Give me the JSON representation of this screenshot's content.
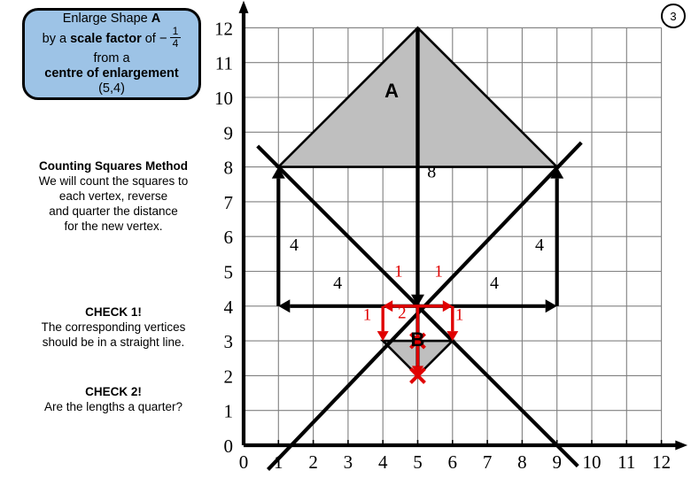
{
  "page": {
    "number": "3"
  },
  "instruction": {
    "line1_prefix": "Enlarge Shape ",
    "line1_shape": "A",
    "line2_prefix": "by a ",
    "line2_bold": "scale factor",
    "line2_suffix": " of",
    "fraction_sign": "−",
    "fraction_numerator": "1",
    "fraction_denominator": "4",
    "line3": "from a",
    "line4": "centre of enlargement",
    "line5": "(5,4)"
  },
  "method": {
    "heading": "Counting Squares Method",
    "lines": [
      "We will count the squares to",
      "each vertex, reverse",
      "and quarter the distance",
      "for the new vertex."
    ]
  },
  "check1": {
    "heading": "CHECK 1!",
    "lines": [
      "The corresponding vertices",
      "should be in a straight line."
    ]
  },
  "check2": {
    "heading": "CHECK 2!",
    "lines": [
      "Are the lengths a quarter?"
    ]
  },
  "colors": {
    "instruction_box_fill": "#9DC3E6",
    "shape_fill": "#BFBFBF",
    "annotation_red": "#E00000",
    "grid": "#808080",
    "axis": "#000000"
  },
  "chart_data": {
    "type": "scatter",
    "title": "",
    "xlabel": "",
    "ylabel": "",
    "xlim": [
      0,
      12
    ],
    "ylim": [
      0,
      12
    ],
    "grid": true,
    "x_ticks": [
      "0",
      "1",
      "2",
      "3",
      "4",
      "5",
      "6",
      "7",
      "8",
      "9",
      "10",
      "11",
      "12"
    ],
    "y_ticks": [
      "0",
      "1",
      "2",
      "3",
      "4",
      "5",
      "6",
      "7",
      "8",
      "9",
      "10",
      "11",
      "12"
    ],
    "shapes": [
      {
        "name": "A",
        "label": "A",
        "label_pos": [
          4.25,
          10.0
        ],
        "fill": "#BFBFBF",
        "vertices": [
          [
            1,
            8
          ],
          [
            5,
            12
          ],
          [
            9,
            8
          ]
        ]
      },
      {
        "name": "B",
        "label": "B",
        "label_pos": [
          5.0,
          2.85
        ],
        "fill": "#BFBFBF",
        "vertices": [
          [
            4,
            3
          ],
          [
            5,
            2
          ],
          [
            6,
            3
          ]
        ]
      }
    ],
    "centre_of_enlargement": [
      5,
      4
    ],
    "ray_lines": [
      {
        "from": [
          0.4,
          8.6
        ],
        "to": [
          9.6,
          -0.6
        ],
        "color": "#000000"
      },
      {
        "from": [
          0.7,
          -0.7
        ],
        "to": [
          9.7,
          8.7
        ],
        "color": "#000000"
      },
      {
        "from": [
          5,
          12
        ],
        "to": [
          5,
          2
        ],
        "color": "#000000"
      }
    ],
    "black_measure_arrows": [
      {
        "from": [
          1,
          4
        ],
        "to": [
          1,
          8
        ],
        "label": "4",
        "label_pos": [
          1.45,
          5.6
        ]
      },
      {
        "from": [
          5,
          4
        ],
        "to": [
          1,
          4
        ],
        "label": "4",
        "label_pos": [
          2.7,
          4.5
        ]
      },
      {
        "from": [
          5,
          12
        ],
        "to": [
          5,
          4
        ],
        "label": "8",
        "label_pos": [
          5.4,
          7.7
        ]
      },
      {
        "from": [
          9,
          4
        ],
        "to": [
          9,
          8
        ],
        "label": "4",
        "label_pos": [
          8.5,
          5.6
        ]
      },
      {
        "from": [
          5,
          4
        ],
        "to": [
          9,
          4
        ],
        "label": "4",
        "label_pos": [
          7.2,
          4.5
        ]
      }
    ],
    "red_measure_arrows": [
      {
        "from": [
          5,
          4
        ],
        "to": [
          4,
          4
        ],
        "label": "1",
        "label_pos": [
          4.45,
          4.85
        ]
      },
      {
        "from": [
          4,
          4
        ],
        "to": [
          4,
          3
        ],
        "label": "1",
        "label_pos": [
          3.55,
          3.6
        ]
      },
      {
        "from": [
          5,
          4
        ],
        "to": [
          6,
          4
        ],
        "label": "1",
        "label_pos": [
          5.6,
          4.85
        ]
      },
      {
        "from": [
          6,
          4
        ],
        "to": [
          6,
          3
        ],
        "label": "1",
        "label_pos": [
          6.2,
          3.6
        ]
      },
      {
        "from": [
          5,
          4
        ],
        "to": [
          5,
          2
        ],
        "label": "2",
        "label_pos": [
          4.55,
          3.65
        ]
      }
    ],
    "red_cross_marks": [
      [
        5,
        3
      ],
      [
        5,
        2
      ]
    ]
  }
}
